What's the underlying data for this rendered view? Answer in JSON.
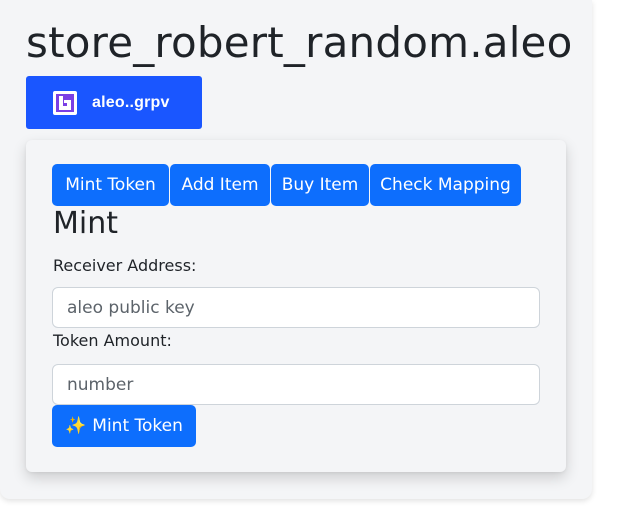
{
  "header": {
    "title": "store_robert_random.aleo"
  },
  "wallet": {
    "address_label": "aleo..grpv",
    "icon": "leo-wallet-icon"
  },
  "tabs": [
    {
      "label": "Mint Token"
    },
    {
      "label": "Add Item"
    },
    {
      "label": "Buy Item"
    },
    {
      "label": "Check Mapping"
    }
  ],
  "mint_form": {
    "title": "Mint",
    "receiver_label": "Receiver Address:",
    "receiver_placeholder": "aleo public key",
    "receiver_value": "",
    "amount_label": "Token Amount:",
    "amount_placeholder": "number",
    "amount_value": "",
    "submit_icon": "✨",
    "submit_label": "Mint Token"
  },
  "colors": {
    "wallet_button": "#1a56ff",
    "primary_button": "#0d6efd",
    "card_background": "#f4f5f7"
  }
}
